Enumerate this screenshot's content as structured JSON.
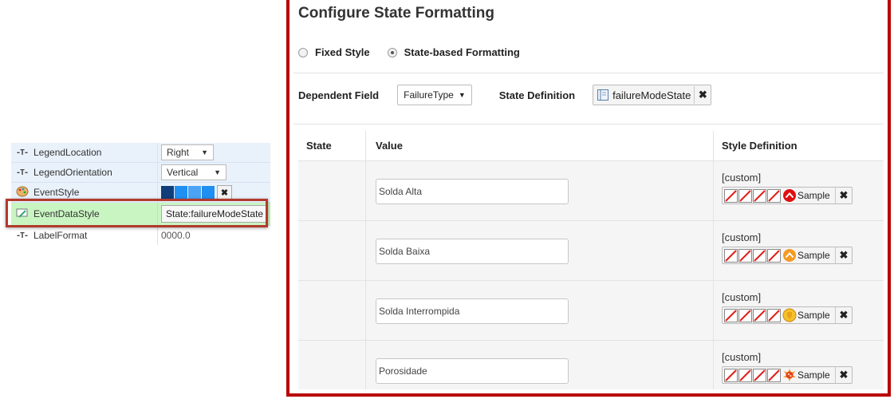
{
  "property_grid": {
    "rows": [
      {
        "name": "LegendLocation",
        "value": "Right"
      },
      {
        "name": "LegendOrientation",
        "value": "Vertical"
      },
      {
        "name": "EventStyle",
        "swatch_colors": [
          "#0f3e7a",
          "#1f8ff2",
          "#4aa3f4",
          "#1f8ff2"
        ],
        "clear": "✖"
      },
      {
        "name": "EventDataStyle",
        "value": "State:failureModeState"
      },
      {
        "name": "LabelFormat",
        "value": "0000.0"
      }
    ],
    "type_icon": "-T-"
  },
  "dialog": {
    "title": "Configure State Formatting",
    "radios": [
      {
        "label": "Fixed Style",
        "selected": false
      },
      {
        "label": "State-based Formatting",
        "selected": true
      }
    ],
    "dependent_field_label": "Dependent Field",
    "dependent_field_value": "FailureType",
    "state_definition_label": "State Definition",
    "state_definition_value": "failureModeState",
    "clear": "✖",
    "arrow": "▼",
    "table": {
      "headers": {
        "state": "State",
        "value": "Value",
        "style": "Style Definition"
      },
      "rows": [
        {
          "value": "Solda Alta",
          "custom": "[custom]",
          "sample": "Sample",
          "icon": "red-circle-caret-icon",
          "color": "#e01010"
        },
        {
          "value": "Solda Baixa",
          "custom": "[custom]",
          "sample": "Sample",
          "icon": "orange-circle-caret-icon",
          "color": "#f59a22"
        },
        {
          "value": "Solda Interrompida",
          "custom": "[custom]",
          "sample": "Sample",
          "icon": "yellow-shield-icon",
          "color": "#f7c12c"
        },
        {
          "value": "Porosidade",
          "custom": "[custom]",
          "sample": "Sample",
          "icon": "red-dotted-burst-icon",
          "color": "#e8401c"
        }
      ]
    }
  }
}
